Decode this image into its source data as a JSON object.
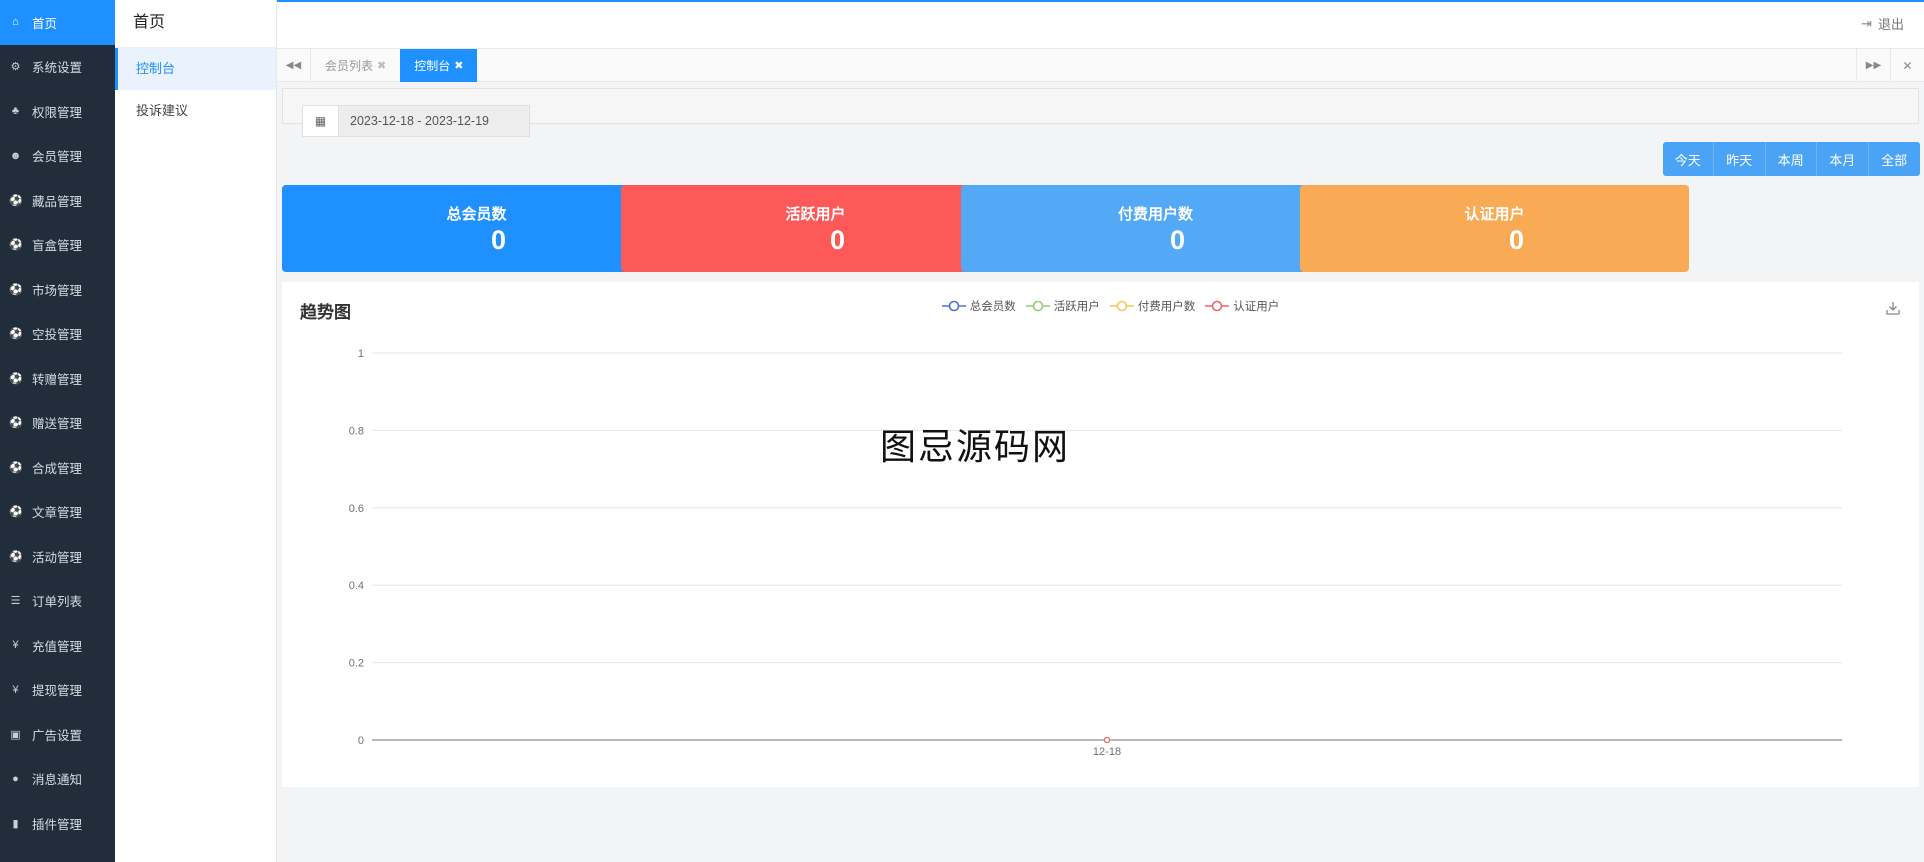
{
  "sidebar": {
    "items": [
      {
        "label": "首页",
        "icon": "home-icon",
        "glyph": "⌂",
        "active": true
      },
      {
        "label": "系统设置",
        "icon": "gear-icon",
        "glyph": "⚙",
        "active": false
      },
      {
        "label": "权限管理",
        "icon": "sitemap-icon",
        "glyph": "♣",
        "active": false
      },
      {
        "label": "会员管理",
        "icon": "users-icon",
        "glyph": "☻",
        "active": false
      },
      {
        "label": "藏品管理",
        "icon": "soccer-ball-icon",
        "glyph": "⚽",
        "active": false
      },
      {
        "label": "盲盒管理",
        "icon": "soccer-ball-icon",
        "glyph": "⚽",
        "active": false
      },
      {
        "label": "市场管理",
        "icon": "soccer-ball-icon",
        "glyph": "⚽",
        "active": false
      },
      {
        "label": "空投管理",
        "icon": "soccer-ball-icon",
        "glyph": "⚽",
        "active": false
      },
      {
        "label": "转赠管理",
        "icon": "soccer-ball-icon",
        "glyph": "⚽",
        "active": false
      },
      {
        "label": "赠送管理",
        "icon": "soccer-ball-icon",
        "glyph": "⚽",
        "active": false
      },
      {
        "label": "合成管理",
        "icon": "soccer-ball-icon",
        "glyph": "⚽",
        "active": false
      },
      {
        "label": "文章管理",
        "icon": "soccer-ball-icon",
        "glyph": "⚽",
        "active": false
      },
      {
        "label": "活动管理",
        "icon": "soccer-ball-icon",
        "glyph": "⚽",
        "active": false
      },
      {
        "label": "订单列表",
        "icon": "signpost-icon",
        "glyph": "☰",
        "active": false
      },
      {
        "label": "充值管理",
        "icon": "yen-icon",
        "glyph": "¥",
        "active": false
      },
      {
        "label": "提现管理",
        "icon": "yen-icon",
        "glyph": "¥",
        "active": false
      },
      {
        "label": "广告设置",
        "icon": "image-icon",
        "glyph": "▣",
        "active": false
      },
      {
        "label": "消息通知",
        "icon": "comment-icon",
        "glyph": "●",
        "active": false
      },
      {
        "label": "插件管理",
        "icon": "plug-icon",
        "glyph": "▮",
        "active": false
      }
    ]
  },
  "submenu": {
    "title": "首页",
    "items": [
      {
        "label": "控制台",
        "active": true
      },
      {
        "label": "投诉建议",
        "active": false
      }
    ]
  },
  "topbar": {
    "logout_label": "退出"
  },
  "tabs": [
    {
      "label": "会员列表",
      "active": false
    },
    {
      "label": "控制台",
      "active": true
    }
  ],
  "filter": {
    "date_range": "2023-12-18 - 2023-12-19",
    "range_buttons": [
      "今天",
      "昨天",
      "本周",
      "本月",
      "全部"
    ]
  },
  "stats": [
    {
      "label": "总会员数",
      "value": "0",
      "color": "#1e90ff"
    },
    {
      "label": "活跃用户",
      "value": "0",
      "color": "#fe5959"
    },
    {
      "label": "付费用户数",
      "value": "0",
      "color": "#53a9f5"
    },
    {
      "label": "认证用户",
      "value": "0",
      "color": "#f8aa55"
    }
  ],
  "watermark": "图忌源码网",
  "chart_data": {
    "type": "line",
    "title": "趋势图",
    "categories": [
      "12-18"
    ],
    "series": [
      {
        "name": "总会员数",
        "values": [
          0
        ],
        "color": "#5470c6"
      },
      {
        "name": "活跃用户",
        "values": [
          0
        ],
        "color": "#91cc75"
      },
      {
        "name": "付费用户数",
        "values": [
          0
        ],
        "color": "#fac858"
      },
      {
        "name": "认证用户",
        "values": [
          0
        ],
        "color": "#ee6666"
      }
    ],
    "ylim": [
      0,
      1
    ],
    "yticks": [
      "0",
      "0.2",
      "0.4",
      "0.6",
      "0.8",
      "1"
    ],
    "grid": true,
    "legend": "top-center"
  }
}
